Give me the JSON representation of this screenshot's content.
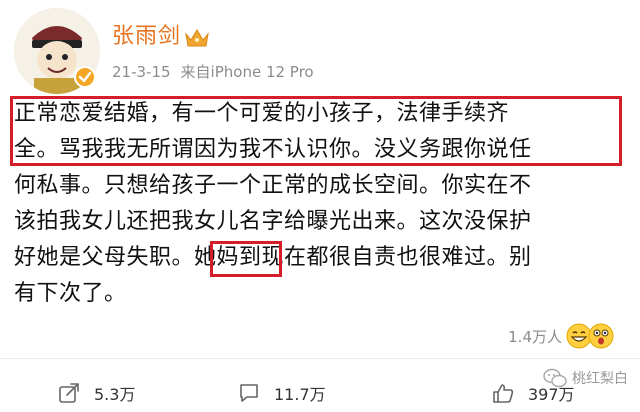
{
  "user": {
    "name": "张雨剑",
    "timestamp": "21-3-15",
    "source": "来自iPhone 12 Pro"
  },
  "post": {
    "lines": [
      "正常恋爱结婚，有一个可爱的小孩子，法律手续齐",
      "全。骂我我无所谓因为我不认识你。没义务跟你说任",
      "何私事。只想给孩子一个正常的成长空间。你实在不",
      "该拍我女儿还把我女儿名字给曝光出来。这次没保护",
      "好她是父母失职。她妈到现在都很自责也很难过。别",
      "有下次了。"
    ]
  },
  "reactions": {
    "count": "1.4万人"
  },
  "actions": {
    "share": "5.3万",
    "comment": "11.7万",
    "like": "397万"
  },
  "watermark": "桃红梨白",
  "colors": {
    "username": "#e8731f",
    "highlight_border": "#d61e2b",
    "verified_badge": "#f5a623",
    "meta_text": "#8c8c8c"
  }
}
